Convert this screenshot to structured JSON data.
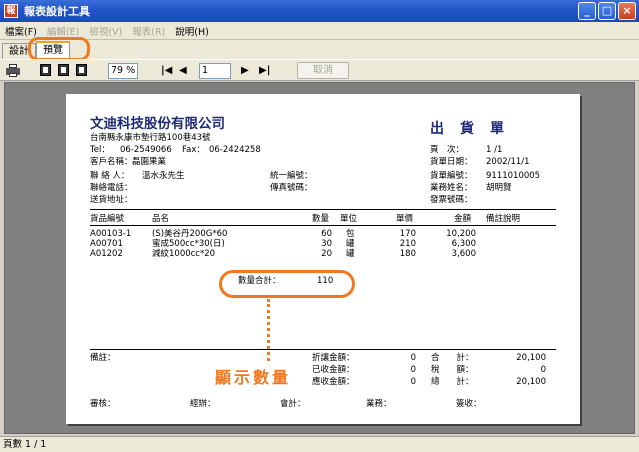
{
  "window": {
    "title": "報表設計工具",
    "app_icon": "報",
    "minimize": "_",
    "maximize": "□",
    "close": "×"
  },
  "menu": [
    {
      "label": "檔案(F)",
      "enabled": true
    },
    {
      "label": "編輯(E)",
      "enabled": false
    },
    {
      "label": "檢視(V)",
      "enabled": false
    },
    {
      "label": "報表(R)",
      "enabled": false
    },
    {
      "label": "說明(H)",
      "enabled": true
    }
  ],
  "tabs": {
    "design": "設計",
    "preview": "預覽"
  },
  "toolbar": {
    "zoom": "79 %",
    "page": "1",
    "first": "|◀",
    "prev": "◀",
    "next": "▶",
    "last": "▶|",
    "cancel": "取消"
  },
  "report": {
    "company": "文迪科技股份有限公司",
    "address": "台南縣永康市墊行路100巷43號",
    "tel_label": "Tel：",
    "tel": "06-2549066",
    "fax_label": "Fax：",
    "fax": "06-2424258",
    "doc_title": "出貨單",
    "page_label": "頁　次：",
    "page_value": "1 /1",
    "ship_date_label": "貨單日期：",
    "ship_date": "2002/11/1",
    "ship_no_label": "貨單編號：",
    "ship_no": "9111010005",
    "sales_label": "業務姓名：",
    "sales": "胡明賢",
    "invoice_label": "發票號碼：",
    "customer_label": "客戶名稱：",
    "customer": "磊園果業",
    "contact_label": "聯 絡 人：",
    "contact": "溫水永先生",
    "tax_id_label": "統一編號：",
    "phone_label": "聯絡電話：",
    "fax2_label": "傳真號碼：",
    "delivery_label": "送貨地址：",
    "columns": {
      "code": "貨品編號",
      "name": "品名",
      "qty": "數量",
      "unit": "單位",
      "price": "單價",
      "amount": "金額",
      "note": "備註說明"
    },
    "items": [
      {
        "code": "A00103-1",
        "name": "(S)美谷丹200G*60",
        "qty": "60",
        "unit": "包",
        "price": "170",
        "amount": "10,200"
      },
      {
        "code": "A00701",
        "name": "蜜成500cc*30(日)",
        "qty": "30",
        "unit": "罐",
        "price": "210",
        "amount": "6,300"
      },
      {
        "code": "A01202",
        "name": "減紋1000cc*20",
        "qty": "20",
        "unit": "罐",
        "price": "180",
        "amount": "3,600"
      }
    ],
    "qty_total_label": "數量合計：",
    "qty_total": "110",
    "remarks_label": "備註：",
    "discount_label": "折讓金額：",
    "discount": "0",
    "received_label": "已收金額：",
    "received": "0",
    "receivable_label": "應收金額：",
    "receivable": "0",
    "subtotal_label": "合　　計：",
    "subtotal": "20,100",
    "tax_label": "稅　　額：",
    "tax": "0",
    "total_label": "總　　計：",
    "total": "20,100",
    "sign": {
      "review": "審核：",
      "handler": "經辦：",
      "accounting": "會計：",
      "business": "業務：",
      "receiver": "簽收："
    }
  },
  "annotation": "顯示數量",
  "status": "頁數 1 / 1",
  "colors": {
    "callout": "#f07820",
    "company": "#1e2a78",
    "titlebar": "#2456c6"
  }
}
